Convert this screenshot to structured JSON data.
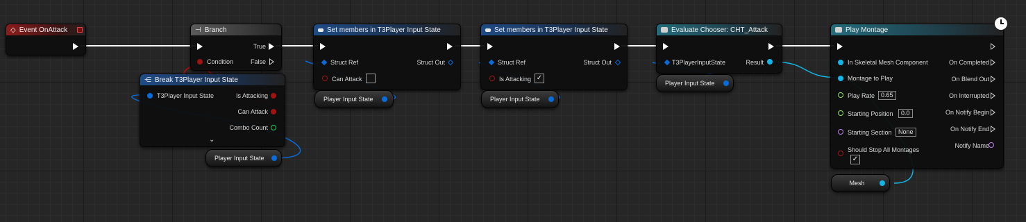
{
  "colors": {
    "exec": "#ffffff",
    "struct": "#0a6cd8",
    "bool": "#a01313",
    "int": "#1bd15a",
    "float": "#8ee35b",
    "name": "#c281f2",
    "object": "#12b7e8"
  },
  "nodes": {
    "event": {
      "title": "Event OnAttack",
      "icon": "event-diamond-icon"
    },
    "branch": {
      "title": "Branch",
      "true_label": "True",
      "condition_label": "Condition",
      "false_label": "False"
    },
    "break": {
      "title": "Break T3Player Input State",
      "pin_in": "T3Player Input State",
      "out1": "Is Attacking",
      "out2": "Can Attack",
      "out3": "Combo Count",
      "expand_icon": "chevron-down-icon"
    },
    "var1": {
      "label": "Player Input State"
    },
    "set1": {
      "title": "Set members in T3Player Input State",
      "struct_ref": "Struct Ref",
      "struct_out": "Struct Out",
      "field": "Can Attack",
      "checked": false
    },
    "var2": {
      "label": "Player Input State"
    },
    "set2": {
      "title": "Set members in T3Player Input State",
      "struct_ref": "Struct Ref",
      "struct_out": "Struct Out",
      "field": "Is Attacking",
      "checked": true
    },
    "var3": {
      "label": "Player Input State"
    },
    "chooser": {
      "title": "Evaluate Chooser: CHT_Attack",
      "pin_in": "T3PlayerInputState",
      "result": "Result"
    },
    "var4": {
      "label": "Player Input State"
    },
    "montage": {
      "title": "Play Montage",
      "in_skeletal": "In Skeletal Mesh Component",
      "montage_to_play": "Montage to Play",
      "play_rate": "Play Rate",
      "play_rate_val": "0.65",
      "starting_position": "Starting Position",
      "starting_position_val": "0.0",
      "starting_section": "Starting Section",
      "starting_section_val": "None",
      "should_stop": "Should Stop All Montages",
      "should_stop_checked": true,
      "on_completed": "On Completed",
      "on_blend_out": "On Blend Out",
      "on_interrupted": "On Interrupted",
      "on_notify_begin": "On Notify Begin",
      "on_notify_end": "On Notify End",
      "notify_name": "Notify Name",
      "latent_icon": "clock-icon"
    },
    "var5": {
      "label": "Mesh"
    }
  }
}
